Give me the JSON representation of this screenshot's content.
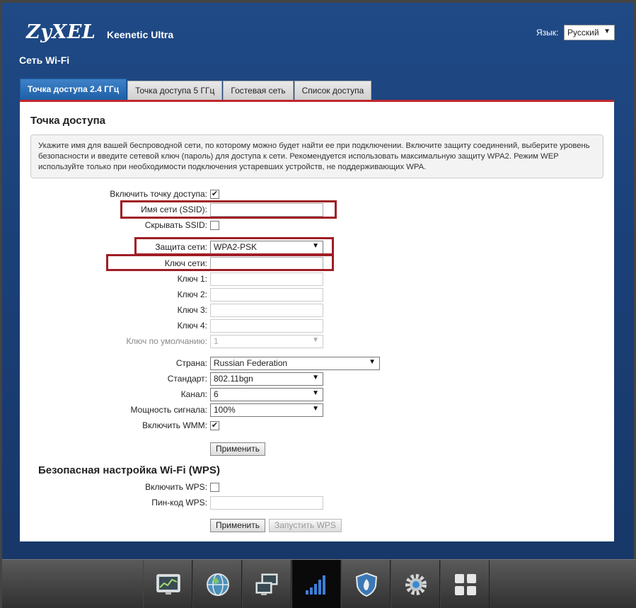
{
  "header": {
    "logo": "ZyXEL",
    "product": "Keenetic Ultra",
    "language_label": "Язык:",
    "language_value": "Русский"
  },
  "page_title": "Сеть Wi-Fi",
  "tabs": [
    {
      "label": "Точка доступа 2.4 ГГц",
      "active": true
    },
    {
      "label": "Точка доступа 5 ГГц",
      "active": false
    },
    {
      "label": "Гостевая сеть",
      "active": false
    },
    {
      "label": "Список доступа",
      "active": false
    }
  ],
  "access_point": {
    "heading": "Точка доступа",
    "info": "Укажите имя для вашей беспроводной сети, по которому можно будет найти ее при подключении. Включите защиту соединений, выберите уровень безопасности и введите сетевой ключ (пароль) для доступа к сети. Рекомендуется использовать максимальную защиту WPA2. Режим WEP используйте только при необходимости подключения устаревших устройств, не поддерживающих WPA.",
    "enable_label": "Включить точку доступа:",
    "enable_checked": true,
    "ssid_label": "Имя сети (SSID):",
    "ssid_value": "",
    "hide_ssid_label": "Скрывать SSID:",
    "hide_ssid_checked": false,
    "security_label": "Защита сети:",
    "security_value": "WPA2-PSK",
    "key_label": "Ключ сети:",
    "key_value": "",
    "key1_label": "Ключ 1:",
    "key2_label": "Ключ 2:",
    "key3_label": "Ключ 3:",
    "key4_label": "Ключ 4:",
    "default_key_label": "Ключ по умолчанию:",
    "default_key_value": "1",
    "country_label": "Страна:",
    "country_value": "Russian Federation",
    "standard_label": "Стандарт:",
    "standard_value": "802.11bgn",
    "channel_label": "Канал:",
    "channel_value": "6",
    "power_label": "Мощность сигнала:",
    "power_value": "100%",
    "wmm_label": "Включить WMM:",
    "wmm_checked": true,
    "apply_label": "Применить"
  },
  "wps": {
    "heading": "Безопасная настройка Wi-Fi (WPS)",
    "enable_label": "Включить WPS:",
    "enable_checked": false,
    "pin_label": "Пин-код WPS:",
    "pin_value": "",
    "apply_label": "Применить",
    "start_label": "Запустить WPS"
  },
  "colors": {
    "accent_red": "#a01d24",
    "tab_active": "#1d5fa6",
    "background": "#1b4078"
  },
  "dock": [
    {
      "icon": "monitor-chart-icon",
      "active": false
    },
    {
      "icon": "globe-icon",
      "active": false
    },
    {
      "icon": "network-computers-icon",
      "active": false
    },
    {
      "icon": "wifi-signal-bars-icon",
      "active": true
    },
    {
      "icon": "shield-icon",
      "active": false
    },
    {
      "icon": "gear-icon",
      "active": false
    },
    {
      "icon": "apps-grid-icon",
      "active": false
    }
  ]
}
